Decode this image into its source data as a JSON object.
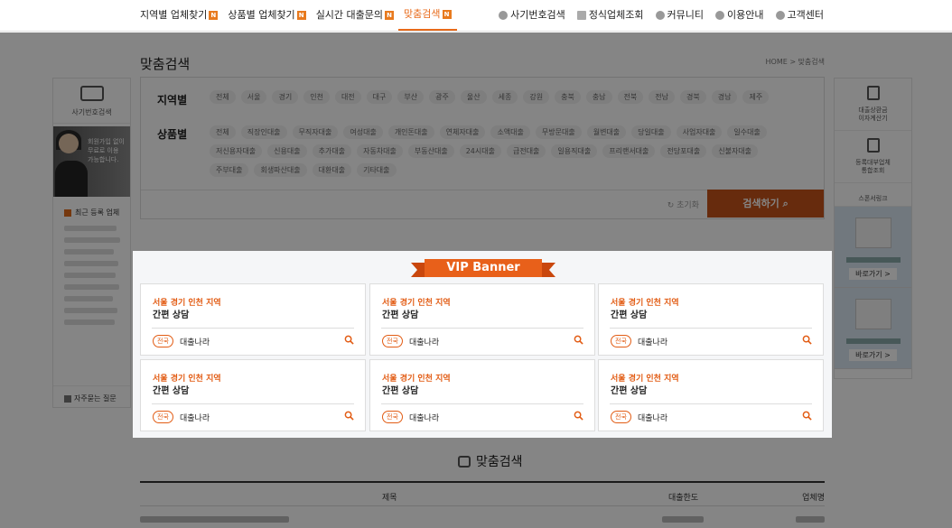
{
  "nav": {
    "left": [
      {
        "label": "지역별 업체찾기",
        "badge": "N"
      },
      {
        "label": "상품별 업체찾기",
        "badge": "N"
      },
      {
        "label": "실시간 대출문의",
        "badge": "N"
      },
      {
        "label": "맞춤검색",
        "badge": "N",
        "active": true
      }
    ],
    "right": [
      {
        "label": "사기번호검색",
        "icon": "search-icon"
      },
      {
        "label": "정식업체조회",
        "icon": "document-icon"
      },
      {
        "label": "커뮤니티",
        "icon": "chat-icon"
      },
      {
        "label": "이용안내",
        "icon": "check-icon"
      },
      {
        "label": "고객센터",
        "icon": "user-icon"
      }
    ]
  },
  "page": {
    "title": "맞춤검색",
    "breadcrumb": "HOME > 맞춤검색"
  },
  "left_sidebar": {
    "fraud_search": "사기번호검색",
    "banner_text": "회원가입 없이\n무료로 이용\n가능합니다.",
    "recent": "최근 등록 업체",
    "faq": "자주묻는 질문"
  },
  "right_sidebar": {
    "calc": "대출상환금\n이자계산기",
    "registry": "등록대부업체\n통합조회",
    "sponsor": "스폰서링크",
    "go1": "바로가기 >",
    "go2": "바로가기 >"
  },
  "search": {
    "region_label": "지역별",
    "regions": [
      "전체",
      "서울",
      "경기",
      "인천",
      "대전",
      "대구",
      "부산",
      "광주",
      "울산",
      "세종",
      "강원",
      "충북",
      "충남",
      "전북",
      "전남",
      "경북",
      "경남",
      "제주"
    ],
    "product_label": "상품별",
    "products": [
      "전체",
      "직장인대출",
      "무직자대출",
      "여성대출",
      "개인돈대출",
      "연체자대출",
      "소액대출",
      "무방문대출",
      "월변대출",
      "당일대출",
      "사업자대출",
      "일수대출",
      "저신용자대출",
      "신용대출",
      "추가대출",
      "자동차대출",
      "부동산대출",
      "24시대출",
      "급전대출",
      "일용직대출",
      "프리랜서대출",
      "전당포대출",
      "신불자대출",
      "주부대출",
      "회생파산대출",
      "대환대출",
      "기타대출"
    ],
    "reset": "초기화",
    "submit": "검색하기"
  },
  "vip": {
    "banner": "VIP Banner",
    "cards": [
      {
        "line1": "서울 경기 인천 지역",
        "line2": "간편 상담",
        "badge": "전국",
        "name": "대출나라"
      },
      {
        "line1": "서울 경기 인천 지역",
        "line2": "간편 상담",
        "badge": "전국",
        "name": "대출나라"
      },
      {
        "line1": "서울 경기 인천 지역",
        "line2": "간편 상담",
        "badge": "전국",
        "name": "대출나라"
      },
      {
        "line1": "서울 경기 인천 지역",
        "line2": "간편 상담",
        "badge": "전국",
        "name": "대출나라"
      },
      {
        "line1": "서울 경기 인천 지역",
        "line2": "간편 상담",
        "badge": "전국",
        "name": "대출나라"
      },
      {
        "line1": "서울 경기 인천 지역",
        "line2": "간편 상담",
        "badge": "전국",
        "name": "대출나라"
      }
    ]
  },
  "results": {
    "heading": "맞춤검색",
    "col_title": "제목",
    "col_limit": "대출한도",
    "col_company": "업체명"
  }
}
